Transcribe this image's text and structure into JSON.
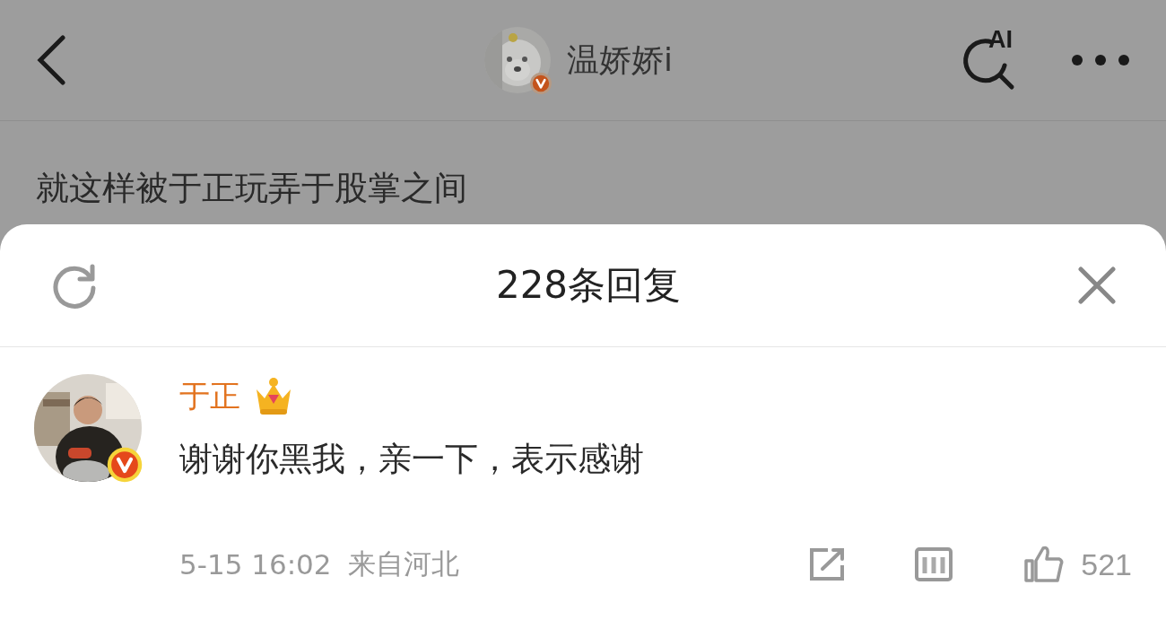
{
  "header": {
    "author": "温娇娇i",
    "ai_label": "AI"
  },
  "post": {
    "text": "就这样被于正玩弄于股掌之间"
  },
  "replies": {
    "title": "228条回复"
  },
  "comment": {
    "author": "于正",
    "text": "谢谢你黑我，亲一下，表示感谢",
    "time": "5-15 16:02",
    "location": "来自河北",
    "likes": "521"
  }
}
